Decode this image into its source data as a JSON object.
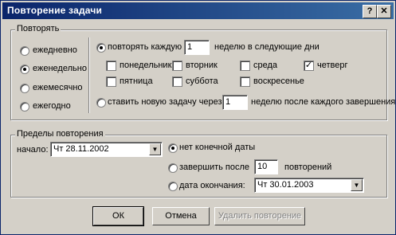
{
  "window": {
    "title": "Повторение задачи",
    "help_label": "?",
    "close_label": "✕"
  },
  "repeat": {
    "group_label": "Повторять",
    "options": [
      "ежедневно",
      "еженедельно",
      "ежемесячно",
      "ежегодно"
    ],
    "every_prefix": "повторять каждую",
    "every_value": "1",
    "every_suffix": "неделю в следующие дни",
    "days": [
      "понедельник",
      "вторник",
      "среда",
      "четверг",
      "пятница",
      "суббота",
      "воскресенье"
    ],
    "checked_day": "четверг",
    "regen_prefix": "ставить новую задачу через",
    "regen_value": "1",
    "regen_suffix": "неделю после каждого завершения"
  },
  "limits": {
    "group_label": "Пределы повторения",
    "start_label": "начало:",
    "start_value": "Чт 28.11.2002",
    "no_end": "нет конечной даты",
    "end_after": "завершить после",
    "count_value": "10",
    "count_suffix": "повторений",
    "end_by": "дата окончания:",
    "end_date": "Чт 30.01.2003"
  },
  "buttons": {
    "ok": "ОК",
    "cancel": "Отмена",
    "remove": "Удалить повторение"
  }
}
